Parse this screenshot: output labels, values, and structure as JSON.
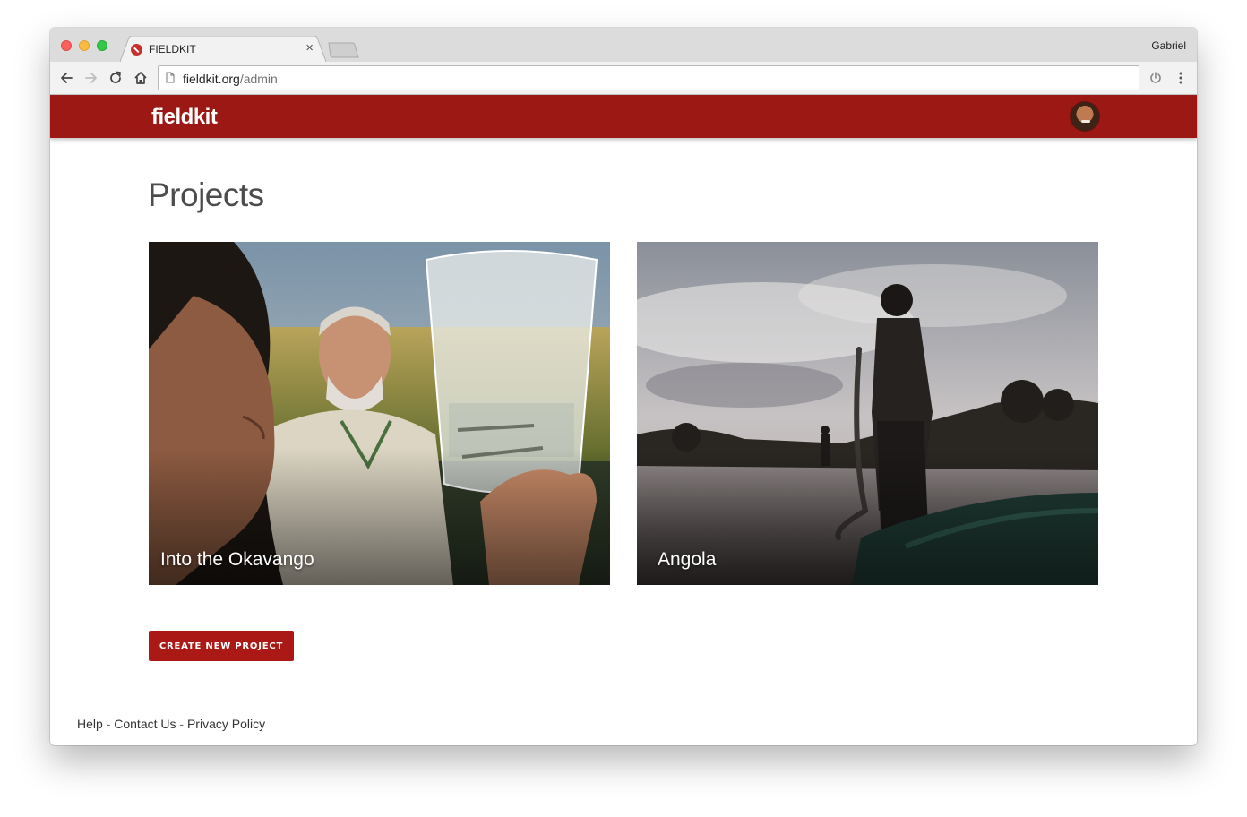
{
  "browser": {
    "tab_title": "FIELDKIT",
    "tab_close": "×",
    "profile_name": "Gabriel",
    "url_host": "fieldkit.org",
    "url_path": "/admin"
  },
  "app": {
    "logo_text": "fieldkit",
    "brand_color": "#9b1815"
  },
  "main": {
    "page_title": "Projects",
    "projects": [
      {
        "title": "Into the Okavango"
      },
      {
        "title": "Angola"
      }
    ],
    "create_button": "CREATE NEW PROJECT"
  },
  "footer": {
    "links": [
      "Help",
      "Contact Us",
      "Privacy Policy"
    ],
    "separator": "-"
  }
}
